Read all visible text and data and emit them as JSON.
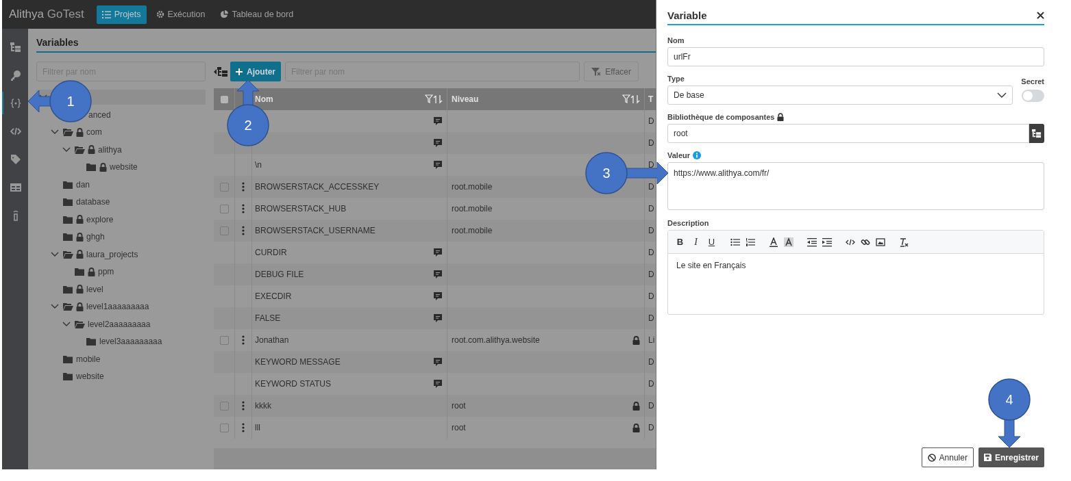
{
  "nav": {
    "logo_main": "Alithya",
    "logo_sub": "GoTest",
    "tabs": [
      {
        "kind": "list",
        "label": "Projets",
        "selected": true
      },
      {
        "kind": "gear",
        "label": "Exécution",
        "selected": false
      },
      {
        "kind": "pie",
        "label": "Tableau de bord",
        "selected": false
      }
    ]
  },
  "sidebar": {
    "items": [
      {
        "kind": "tree",
        "selected": false
      },
      {
        "kind": "key",
        "selected": false
      },
      {
        "kind": "braces",
        "selected": true
      },
      {
        "kind": "code",
        "selected": false
      },
      {
        "kind": "tag",
        "selected": false
      },
      {
        "kind": "table",
        "selected": false
      },
      {
        "kind": "tower",
        "selected": false
      }
    ]
  },
  "page": {
    "title": "Variables",
    "tree_filter_placeholder": "Filtrer par nom",
    "add_button": "Ajouter",
    "table_filter_placeholder": "Filtrer par nom",
    "clear_button": {
      "label": "Effacer",
      "disabled": true
    }
  },
  "tree": [
    {
      "selected": true,
      "expanded": true,
      "children": [
        {
          "label": "anced",
          "selected": false,
          "expanded": false,
          "locked": false
        },
        {
          "label": "com",
          "selected": false,
          "expanded": true,
          "locked": true,
          "children": [
            {
              "label": "alithya",
              "selected": false,
              "expanded": true,
              "locked": true,
              "children": [
                {
                  "label": "website",
                  "selected": false,
                  "expanded": false,
                  "locked": true
                }
              ]
            }
          ]
        },
        {
          "label": "dan",
          "selected": false,
          "expanded": false,
          "locked": false
        },
        {
          "label": "database",
          "selected": false,
          "expanded": false,
          "locked": false
        },
        {
          "label": "explore",
          "selected": false,
          "expanded": false,
          "locked": true
        },
        {
          "label": "ghgh",
          "selected": false,
          "expanded": false,
          "locked": true
        },
        {
          "label": "laura_projects",
          "selected": false,
          "expanded": true,
          "locked": true,
          "children": [
            {
              "label": "ppm",
              "selected": false,
              "expanded": false,
              "locked": true
            }
          ]
        },
        {
          "label": "level",
          "selected": false,
          "expanded": false,
          "locked": true
        },
        {
          "label": "level1aaaaaaaaa",
          "selected": false,
          "expanded": true,
          "locked": true,
          "children": [
            {
              "label": "level2aaaaaaaaa",
              "selected": false,
              "expanded": true,
              "locked": false,
              "children": [
                {
                  "label": "level3aaaaaaaaa",
                  "selected": false,
                  "expanded": false,
                  "locked": false
                }
              ]
            }
          ]
        },
        {
          "label": "mobile",
          "selected": false,
          "expanded": false,
          "locked": false
        },
        {
          "label": "website",
          "selected": false,
          "expanded": false,
          "locked": false
        }
      ]
    }
  ],
  "table": {
    "select_all_checked": false,
    "columns": [
      "Nom",
      "Niveau",
      "T"
    ],
    "rows": [
      {
        "kind": "system",
        "type": "D"
      },
      {
        "kind": "system",
        "type": "D"
      },
      {
        "kind": "system",
        "name": "\\n",
        "type": "D"
      },
      {
        "kind": "user",
        "checked": false,
        "name": "BROWSERSTACK_ACCESSKEY",
        "level": "root.mobile",
        "locked": false,
        "type": "D"
      },
      {
        "kind": "user",
        "checked": false,
        "name": "BROWSERSTACK_HUB",
        "level": "root.mobile",
        "locked": false,
        "type": "D"
      },
      {
        "kind": "user",
        "checked": false,
        "name": "BROWSERSTACK_USERNAME",
        "level": "root.mobile",
        "locked": false,
        "type": "D"
      },
      {
        "kind": "system",
        "name": "CURDIR",
        "type": "D"
      },
      {
        "kind": "system",
        "name": "DEBUG FILE",
        "type": "D"
      },
      {
        "kind": "system",
        "name": "EXECDIR",
        "type": "D"
      },
      {
        "kind": "system",
        "name": "FALSE",
        "type": "D"
      },
      {
        "kind": "user",
        "checked": false,
        "name": "Jonathan",
        "level": "root.com.alithya.website",
        "locked": true,
        "type": "Li"
      },
      {
        "kind": "system",
        "name": "KEYWORD MESSAGE",
        "type": "D"
      },
      {
        "kind": "system",
        "name": "KEYWORD STATUS",
        "type": "D"
      },
      {
        "kind": "user",
        "checked": false,
        "name": "kkkk",
        "level": "root",
        "locked": true,
        "type": "D"
      },
      {
        "kind": "user",
        "checked": false,
        "name": "lll",
        "level": "root",
        "locked": true,
        "type": "D"
      }
    ]
  },
  "drawer": {
    "title": "Variable",
    "name_label": "Nom",
    "name_value": "urlFr",
    "type_label": "Type",
    "type_value": "De base",
    "secret_label": "Secret",
    "secret_on": false,
    "library_label": "Bibliothèque de composantes",
    "library_value": "root",
    "value_label": "Valeur",
    "value_text": "https://www.alithya.com/fr/",
    "description_label": "Description",
    "toolbar": [
      {
        "kind": "bold",
        "label": "B"
      },
      {
        "kind": "italic",
        "label": "I"
      },
      {
        "kind": "underline",
        "label": "U"
      },
      {
        "kind": "bullets"
      },
      {
        "kind": "numbers"
      },
      {
        "kind": "color"
      },
      {
        "kind": "highlight"
      },
      {
        "kind": "outdent"
      },
      {
        "kind": "indent"
      },
      {
        "kind": "code"
      },
      {
        "kind": "link"
      },
      {
        "kind": "image"
      },
      {
        "kind": "clear"
      }
    ],
    "description_text": "Le site en Français",
    "cancel_button": "Annuler",
    "save_button": "Enregistrer"
  },
  "callouts": [
    {
      "number": "1"
    },
    {
      "number": "2"
    },
    {
      "number": "3"
    },
    {
      "number": "4"
    }
  ]
}
